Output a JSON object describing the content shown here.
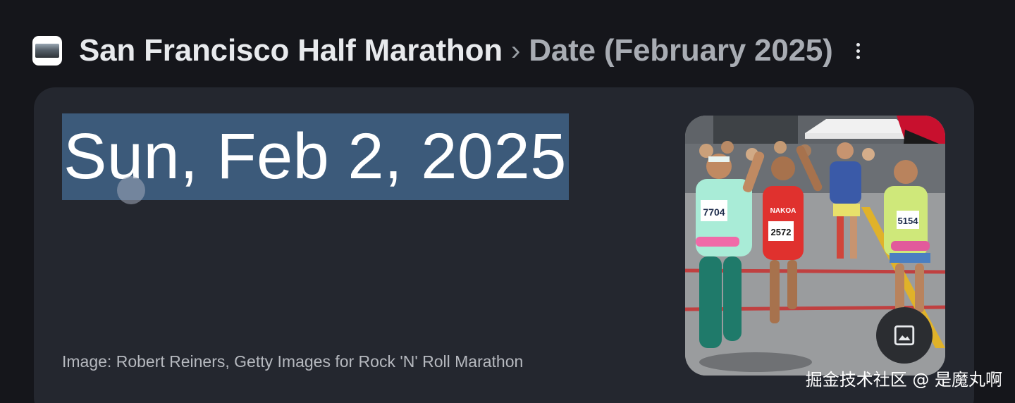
{
  "breadcrumb": {
    "title": "San Francisco Half Marathon",
    "separator": "›",
    "subtitle": "Date (February 2025)"
  },
  "icons": {
    "site": "site-favicon",
    "more": "more-vert-icon",
    "image_view": "image-icon"
  },
  "answer": {
    "date": "Sun, Feb 2, 2025",
    "image_credit": "Image: Robert Reiners, Getty Images for Rock 'N' Roll Marathon"
  },
  "photo": {
    "bibs": [
      "7704",
      "2572",
      "5154"
    ],
    "shirt_text": "NAKOA"
  },
  "watermark": "掘金技术社区 @ 是魔丸啊",
  "colors": {
    "background": "#15161b",
    "card": "#24272f",
    "highlight": "#3c5a7a",
    "title": "#e8eaed",
    "muted": "#a8acb3"
  }
}
